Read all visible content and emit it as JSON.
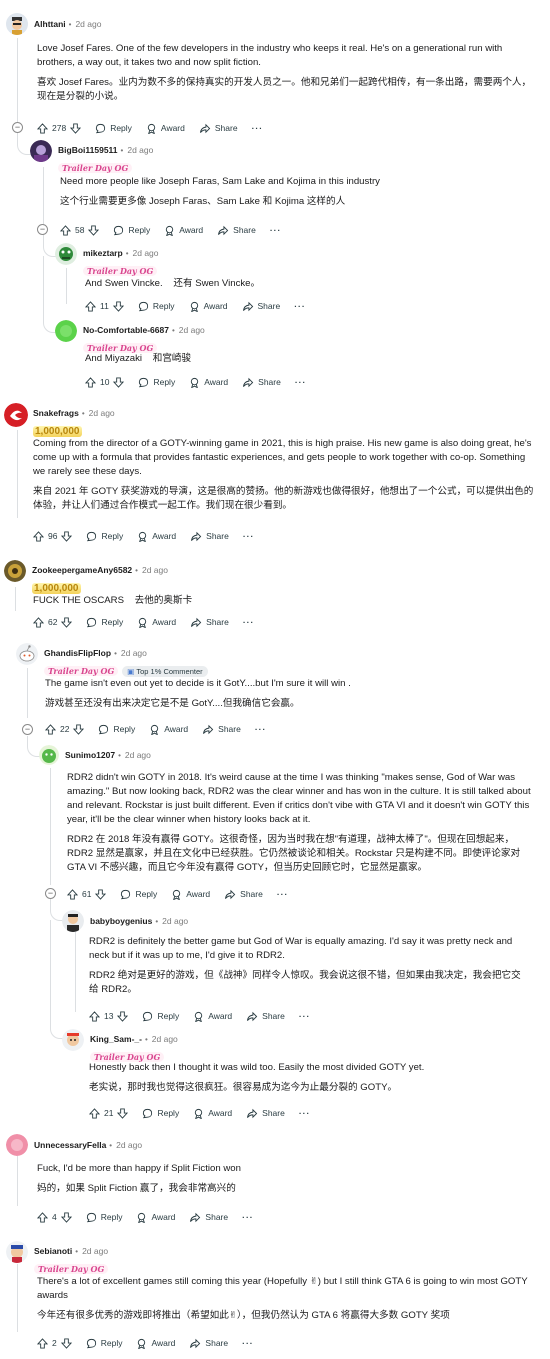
{
  "labels": {
    "reply": "Reply",
    "award": "Award",
    "share": "Share",
    "more": "···"
  },
  "colors": {
    "flair": "#d9468f",
    "gold": "#b8860b",
    "text": "#1a1a1b",
    "muted": "#7c7c7c"
  },
  "comments": [
    {
      "user": "Alhttani",
      "age": "2d ago",
      "avatar": "alhttani-avatar",
      "en": "Love Josef Fares. One of the few developers in the industry who keeps it real. He's on a generational run with brothers, a way out, it takes two and now split fiction.",
      "zh": "喜欢 Josef Fares。业内为数不多的保持真实的开发人员之一。他和兄弟们一起跨代相传，有一条出路，需要两个人，现在是分裂的小说。",
      "votes": "278"
    },
    {
      "user": "BigBoi1159511",
      "age": "2d ago",
      "flair": "Trailer Day OG",
      "en": "Need more people like Joseph Faras, Sam Lake and Kojima in this industry",
      "zh": "这个行业需要更多像 Joseph Faras、Sam Lake 和 Kojima 这样的人",
      "votes": "58"
    },
    {
      "user": "mikeztarp",
      "age": "2d ago",
      "flair": "Trailer Day OG",
      "en": "And Swen Vincke.",
      "zh": "还有 Swen Vincke。",
      "votes": "11"
    },
    {
      "user": "No-Comfortable-6687",
      "age": "2d ago",
      "flair": "Trailer Day OG",
      "en": "And Miyazaki",
      "zh": "和宫崎骏",
      "votes": "10"
    },
    {
      "user": "Snakefrags",
      "age": "2d ago",
      "gold": "1,000,000",
      "en": "Coming from the director of a GOTY-winning game in 2021, this is high praise. His new game is also doing great, he's come up with a formula that provides fantastic experiences, and gets people to work together with co-op. Something we rarely see these days.",
      "zh": "来自 2021 年 GOTY 获奖游戏的导演，这是很高的赞扬。他的新游戏也做得很好，他想出了一个公式，可以提供出色的体验，并让人们通过合作模式一起工作。我们现在很少看到。",
      "votes": "96"
    },
    {
      "user": "ZookeepergameAny6582",
      "age": "2d ago",
      "gold": "1,000,000",
      "en": "FUCK THE OSCARS",
      "zh": "去他的奥斯卡",
      "votes": "62"
    },
    {
      "user": "GhandisFlipFlop",
      "age": "2d ago",
      "flair": "Trailer Day OG",
      "badge": "Top 1% Commenter",
      "en": "The game isn't even out yet to decide is it GotY....but I'm sure it will win .",
      "zh": "游戏甚至还没有出来决定它是不是 GotY....但我确信它会赢。",
      "votes": "22"
    },
    {
      "user": "Sunimo1207",
      "age": "2d ago",
      "en": "RDR2 didn't win GOTY in 2018. It's weird cause at the time I was thinking \"makes sense, God of War was amazing.\" But now looking back, RDR2 was the clear winner and has won in the culture. It is still talked about and relevant. Rockstar is just built different. Even if critics don't vibe with GTA VI and it doesn't win GOTY this year, it'll be the clear winner when history looks back at it.",
      "zh": "RDR2 在 2018 年没有赢得 GOTY。这很奇怪，因为当时我在想\"有道理，战神太棒了\"。但现在回想起来，RDR2 显然是赢家，并且在文化中已经获胜。它仍然被谈论和相关。Rockstar 只是构建不同。即使评论家对 GTA VI 不感兴趣，而且它今年没有赢得 GOTY，但当历史回顾它时，它显然是赢家。",
      "votes": "61"
    },
    {
      "user": "babyboygenius",
      "age": "2d ago",
      "en": "RDR2 is definitely the better game but God of War is equally amazing. I'd say it was pretty neck and neck but if it was up to me, I'd give it to RDR2.",
      "zh": "RDR2 绝对是更好的游戏，但《战神》同样令人惊叹。我会说这很不错，但如果由我决定，我会把它交给 RDR2。",
      "votes": "13"
    },
    {
      "user": "King_Sam-_-",
      "age": "2d ago",
      "flair": "Trailer Day OG",
      "en": "Honestly back then I thought it was wild too. Easily the most divided GOTY yet.",
      "zh": "老实说，那时我也觉得这很疯狂。很容易成为迄今为止最分裂的 GOTY。",
      "votes": "21"
    },
    {
      "user": "UnnecessaryFella",
      "age": "2d ago",
      "en": "Fuck, I'd be more than happy if Split Fiction won",
      "zh": "妈的，如果 Split Fiction 赢了，我会非常高兴的",
      "votes": "4"
    },
    {
      "user": "Sebianoti",
      "age": "2d ago",
      "flair": "Trailer Day OG",
      "en": "There's a lot of excellent games still coming this year (Hopefully ✌) but I still think GTA 6 is going to win most GOTY awards",
      "zh": "今年还有很多优秀的游戏即将推出（希望如此✌），但我仍然认为 GTA 6 将赢得大多数 GOTY 奖项",
      "votes": "2"
    }
  ]
}
